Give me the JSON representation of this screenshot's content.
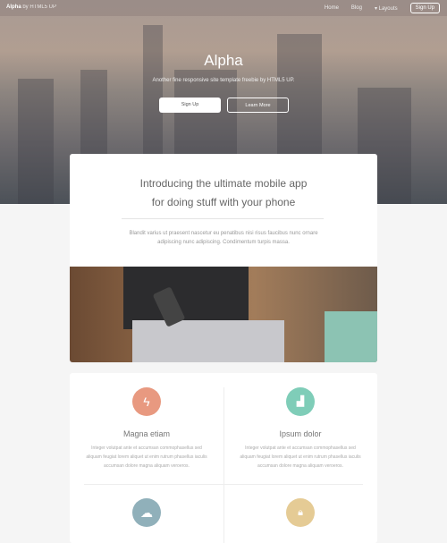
{
  "header": {
    "logo_bold": "Alpha",
    "logo_rest": "by HTML5 UP",
    "nav": [
      "Home",
      "Blog",
      "Layouts"
    ],
    "nav_signup": "Sign Up"
  },
  "hero": {
    "title": "Alpha",
    "subtitle": "Another fine responsive site template freebie by HTML5 UP.",
    "signup": "Sign Up",
    "learn": "Learn More"
  },
  "intro": {
    "heading_line1": "Introducing the ultimate mobile app",
    "heading_line2": "for doing stuff with your phone",
    "text": "Blandit varius ut praesent nascetur eu penatibus nisi risus faucibus nunc ornare adipiscing nunc adipiscing. Condimentum turpis massa."
  },
  "features": [
    {
      "icon": "bolt-icon",
      "color": "#e89980",
      "title": "Magna etiam",
      "text": "Integer volutpat ante et accumsan commophasellus sed aliquam feugiat lorem aliquet ut enim rutrum phasellus iaculis accumsan dolore magna aliquam veroeros."
    },
    {
      "icon": "area-chart-icon",
      "color": "#7fcdb8",
      "title": "Ipsum dolor",
      "text": "Integer volutpat ante et accumsan commophasellus sed aliquam feugiat lorem aliquet ut enim rutrum phasellus iaculis accumsan dolore magna aliquam veroeros."
    },
    {
      "icon": "cloud-icon",
      "color": "#90b0ba"
    },
    {
      "icon": "lock-icon",
      "color": "#e5cb95"
    }
  ]
}
